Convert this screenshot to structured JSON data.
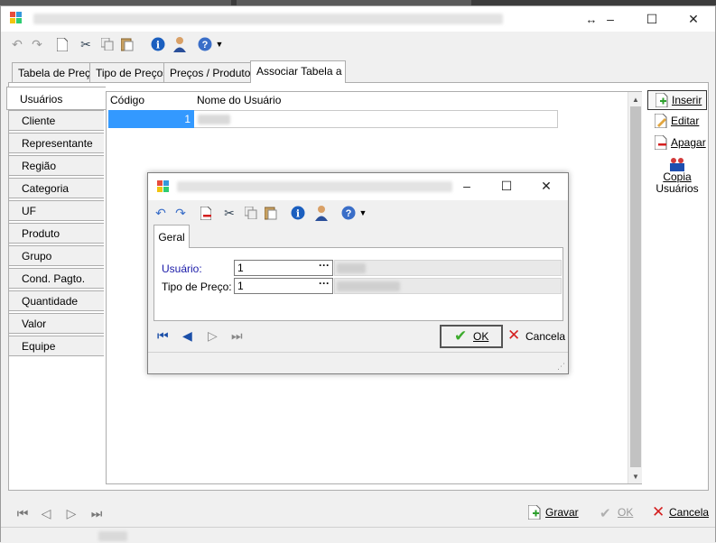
{
  "main_tabs": [
    "Tabela de Preço",
    "Tipo de Preços",
    "Preços / Produtos",
    "Associar Tabela a"
  ],
  "side_tabs": [
    "Usuários",
    "Cliente",
    "Representante",
    "Região",
    "Categoria",
    "UF",
    "Produto",
    "Grupo",
    "Cond. Pagto.",
    "Quantidade",
    "Valor",
    "Equipe"
  ],
  "grid": {
    "col_codigo": "Código",
    "col_nome": "Nome do Usuário",
    "row_code": "1"
  },
  "actions": {
    "inserir": "Inserir",
    "editar": "Editar",
    "apagar": "Apagar",
    "copia_line1": "Copia",
    "copia_line2": "Usuários"
  },
  "bottom": {
    "gravar": "Gravar",
    "ok": "OK",
    "cancela": "Cancela"
  },
  "dialog": {
    "tab": "Geral",
    "usuario_label": "Usuário:",
    "usuario_value": "1",
    "tipo_label": "Tipo de Preço:",
    "tipo_value": "1",
    "ok": "OK",
    "cancela": "Cancela"
  },
  "colors": {
    "selection": "#3399ff",
    "required_label": "#1a1aa8",
    "ok_check": "#3cab2c",
    "cancel_x": "#d42020"
  }
}
